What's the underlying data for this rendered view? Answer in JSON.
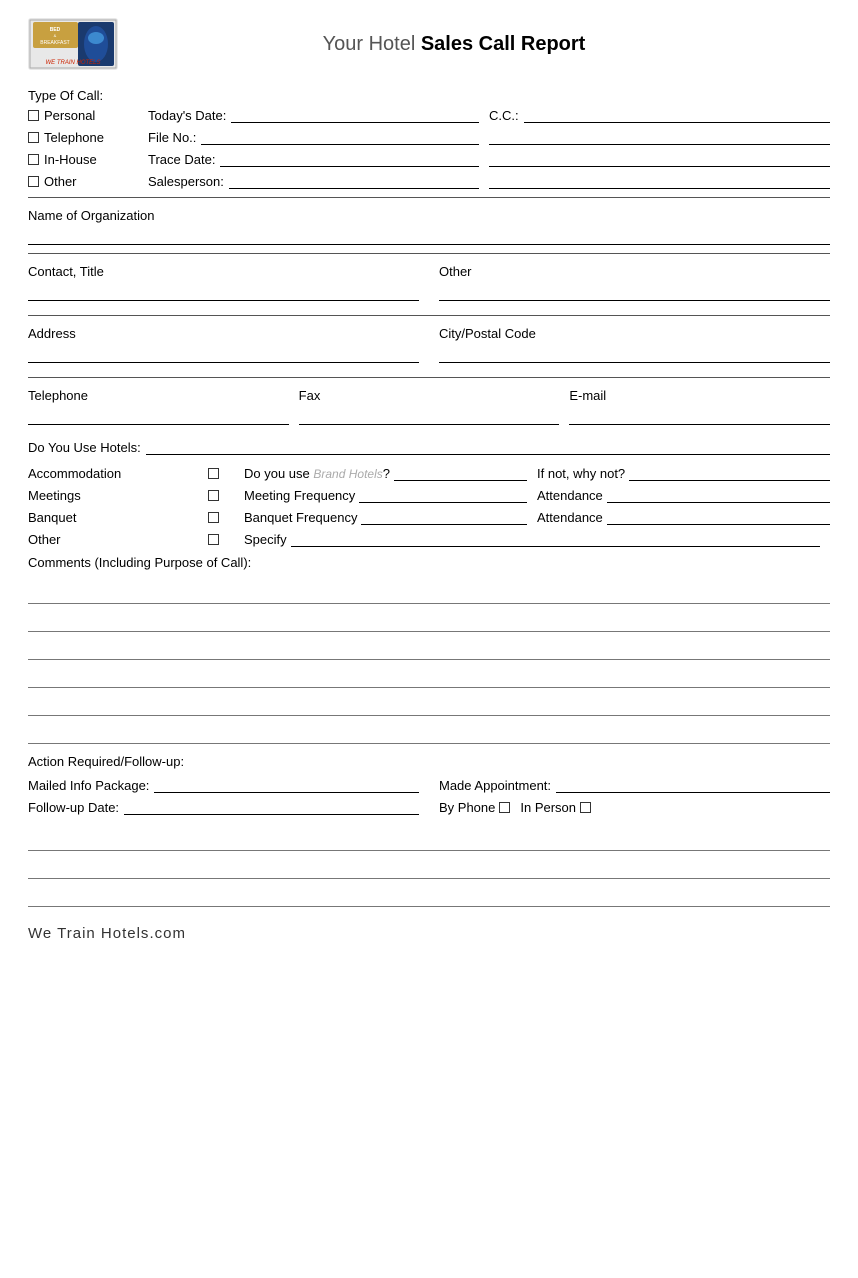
{
  "header": {
    "title_regular": "Your Hotel ",
    "title_bold": "Sales Call Report",
    "logo_alt": "Bed & Breakfast logo"
  },
  "type_of_call": {
    "label": "Type Of Call:",
    "options": [
      {
        "id": "personal",
        "label": "Personal"
      },
      {
        "id": "telephone",
        "label": "Telephone"
      },
      {
        "id": "inhouse",
        "label": "In-House"
      },
      {
        "id": "other",
        "label": "Other"
      }
    ]
  },
  "fields": {
    "todays_date_label": "Today's Date:",
    "cc_label": "C.C.:",
    "file_no_label": "File No.:",
    "trace_date_label": "Trace Date:",
    "salesperson_label": "Salesperson:",
    "name_of_org_label": "Name of Organization",
    "contact_title_label": "Contact, Title",
    "other_label": "Other",
    "address_label": "Address",
    "city_postal_label": "City/Postal Code",
    "telephone_label": "Telephone",
    "fax_label": "Fax",
    "email_label": "E-mail",
    "do_you_use_hotels_label": "Do You Use Hotels:"
  },
  "services": {
    "rows": [
      {
        "name": "Accommodation",
        "detail_label": "Do you use Brand Hotels?",
        "detail2_label": "If not, why not?"
      },
      {
        "name": "Meetings",
        "detail_label": "Meeting Frequency",
        "detail2_label": "Attendance"
      },
      {
        "name": "Banquet",
        "detail_label": "Banquet Frequency",
        "detail2_label": "Attendance"
      },
      {
        "name": "Other",
        "detail_label": "Specify",
        "detail2_label": ""
      }
    ]
  },
  "brand_hotels_italic": "Brand Hotels",
  "comments": {
    "label": "Comments (Including Purpose of Call):",
    "line_count": 6
  },
  "action": {
    "label": "Action Required/Follow-up:",
    "mailed_info_label": "Mailed Info Package:",
    "made_appointment_label": "Made Appointment:",
    "followup_date_label": "Follow-up Date:",
    "by_phone_label": "By Phone",
    "in_person_label": "In Person"
  },
  "footer": {
    "brand_text": "We Train Hotels",
    "brand_suffix": ".com"
  }
}
